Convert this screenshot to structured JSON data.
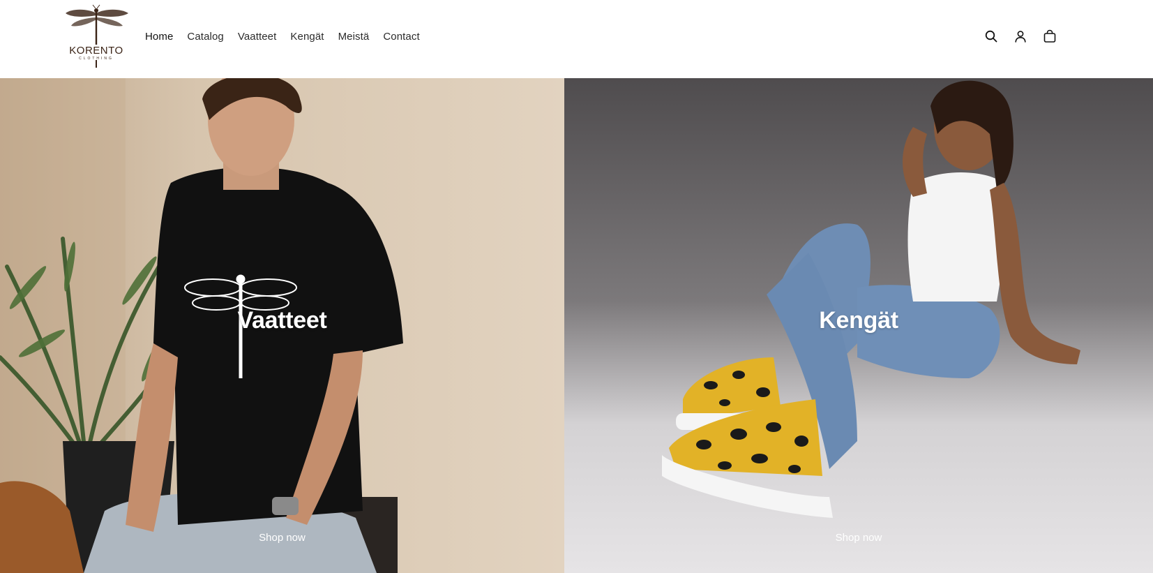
{
  "brand": {
    "name": "KORENTO",
    "tagline": "CLOTHING"
  },
  "nav": {
    "items": [
      {
        "label": "Home"
      },
      {
        "label": "Catalog"
      },
      {
        "label": "Vaatteet"
      },
      {
        "label": "Kengät"
      },
      {
        "label": "Meistä"
      },
      {
        "label": "Contact"
      }
    ]
  },
  "header_icons": [
    "search-icon",
    "account-icon",
    "cart-icon"
  ],
  "collections": [
    {
      "title": "Vaatteet",
      "cta": "Shop now"
    },
    {
      "title": "Kengät",
      "cta": "Shop now"
    }
  ],
  "colors": {
    "logo": "#3a2316",
    "text": "#121212",
    "overlay_text": "#ffffff"
  }
}
